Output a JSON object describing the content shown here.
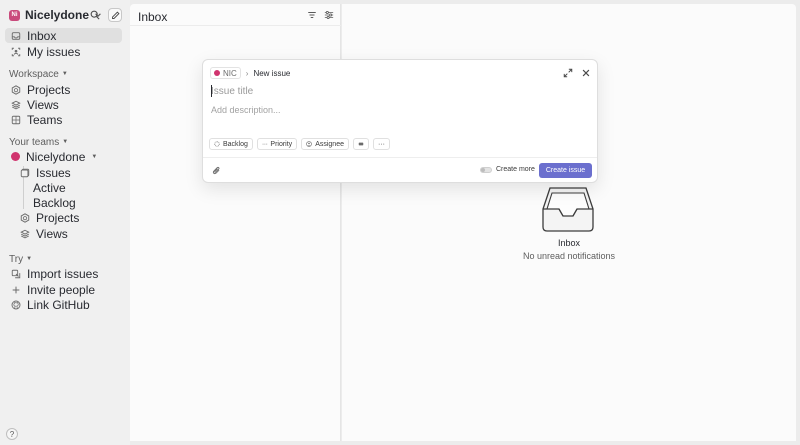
{
  "workspace": {
    "initials": "Ni",
    "name": "Nicelydone"
  },
  "sidebar": {
    "primary": [
      {
        "label": "Inbox",
        "icon": "inbox-icon",
        "active": true
      },
      {
        "label": "My issues",
        "icon": "my-issues-icon",
        "active": false
      }
    ],
    "workspace_section": {
      "label": "Workspace",
      "items": [
        {
          "label": "Projects",
          "icon": "projects-icon"
        },
        {
          "label": "Views",
          "icon": "views-icon"
        },
        {
          "label": "Teams",
          "icon": "teams-icon"
        }
      ]
    },
    "teams_section": {
      "label": "Your teams",
      "team_name": "Nicelydone",
      "items": [
        {
          "label": "Issues",
          "icon": "issues-icon"
        },
        {
          "label": "Active"
        },
        {
          "label": "Backlog"
        },
        {
          "label": "Projects",
          "icon": "projects-icon"
        },
        {
          "label": "Views",
          "icon": "views-icon"
        }
      ]
    },
    "try_section": {
      "label": "Try",
      "items": [
        {
          "label": "Import issues",
          "icon": "import-icon"
        },
        {
          "label": "Invite people",
          "icon": "plus-icon"
        },
        {
          "label": "Link GitHub",
          "icon": "github-icon"
        }
      ]
    },
    "help_label": "?"
  },
  "inbox_panel": {
    "title": "Inbox"
  },
  "empty_state": {
    "title": "Inbox",
    "subtitle": "No unread notifications"
  },
  "modal": {
    "team_key": "NIC",
    "separator": "›",
    "title": "New issue",
    "title_placeholder": "Issue title",
    "description_placeholder": "Add description...",
    "props": {
      "status": "Backlog",
      "priority": "Priority",
      "assignee": "Assignee",
      "more": "···"
    },
    "create_more_label": "Create more",
    "create_more_enabled": false,
    "submit_label": "Create issue"
  },
  "colors": {
    "accent": "#6b6fce",
    "team": "#d0346e",
    "workspace_avatar": "#c94a7c"
  }
}
